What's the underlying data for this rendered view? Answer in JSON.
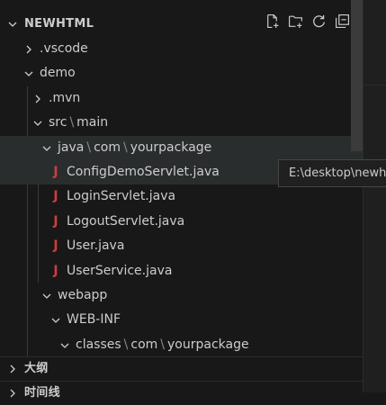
{
  "explorer": {
    "root_label": "NEWHTML",
    "actions": [
      {
        "icon": "new-file-icon"
      },
      {
        "icon": "new-folder-icon"
      },
      {
        "icon": "refresh-icon"
      },
      {
        "icon": "collapse-all-icon"
      }
    ],
    "items": [
      {
        "label": ".vscode",
        "type": "folder",
        "state": "collapsed"
      },
      {
        "label": "demo",
        "type": "folder",
        "state": "expanded"
      },
      {
        "label": ".mvn",
        "type": "folder",
        "state": "collapsed"
      },
      {
        "parts": [
          "src",
          "main"
        ],
        "type": "folder",
        "state": "expanded"
      },
      {
        "parts": [
          "java",
          "com",
          "yourpackage"
        ],
        "type": "folder",
        "state": "expanded"
      },
      {
        "label": "ConfigDemoServlet.java",
        "type": "java"
      },
      {
        "label": "LoginServlet.java",
        "type": "java"
      },
      {
        "label": "LogoutServlet.java",
        "type": "java"
      },
      {
        "label": "User.java",
        "type": "java"
      },
      {
        "label": "UserService.java",
        "type": "java"
      },
      {
        "label": "webapp",
        "type": "folder",
        "state": "expanded"
      },
      {
        "label": "WEB-INF",
        "type": "folder",
        "state": "expanded"
      },
      {
        "parts": [
          "classes",
          "com",
          "yourpackage"
        ],
        "type": "folder",
        "state": "expanded"
      }
    ],
    "java_icon_glyph": "J",
    "path_separator": "\\",
    "outline_label": "大纲",
    "timeline_label": "时间线"
  },
  "tooltip": {
    "text": "E:\\desktop\\newh"
  },
  "colors": {
    "background": "#181818",
    "java_icon": "#d33c3c",
    "hover_row": "#2a2d2e",
    "text": "#cccccc"
  }
}
